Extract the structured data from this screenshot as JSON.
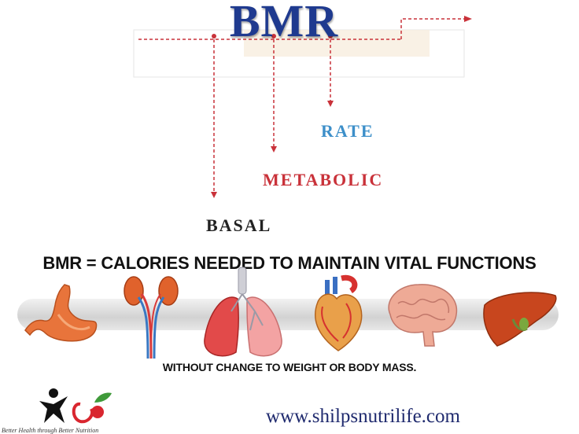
{
  "title": "BMR",
  "words": {
    "rate": "RATE",
    "metabolic": "METABOLIC",
    "basal": "BASAL"
  },
  "definition": "BMR = CALORIES NEEDED TO MAINTAIN VITAL FUNCTIONS",
  "organs": [
    {
      "name": "stomach",
      "icon": "stomach-icon"
    },
    {
      "name": "kidneys",
      "icon": "kidneys-icon"
    },
    {
      "name": "lungs",
      "icon": "lungs-icon"
    },
    {
      "name": "heart",
      "icon": "heart-icon"
    },
    {
      "name": "brain",
      "icon": "brain-icon"
    },
    {
      "name": "liver",
      "icon": "liver-icon"
    }
  ],
  "subtext": "WITHOUT CHANGE TO WEIGHT OR BODY MASS.",
  "website": "www.shilpsnutrilife.com",
  "tagline": "Better Health through Better Nutrition",
  "colors": {
    "title": "#1f3a8f",
    "rate": "#3d8fc9",
    "metabolic": "#c9323a",
    "basal": "#222222",
    "arrow": "#c9323a"
  }
}
